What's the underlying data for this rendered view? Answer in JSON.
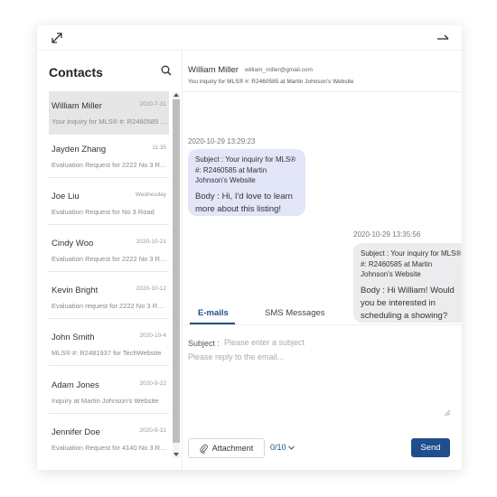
{
  "window": {
    "expand_icon": "expand-icon",
    "minimize_icon": "minimize-icon"
  },
  "contacts": {
    "title": "Contacts",
    "search_icon": "search-icon",
    "items": [
      {
        "name": "William Miller",
        "date": "2020-7-31",
        "preview": "Your inquiry for MLS® #: R2460585 at Martin Johnson's Website",
        "selected": true
      },
      {
        "name": "Jayden Zhang",
        "date": "11:35",
        "preview": "Evaluation Request for 2222 No 3 Road",
        "selected": false
      },
      {
        "name": "Joe Liu",
        "date": "Wednesday",
        "preview": "Evaluation Request for No 3 Road",
        "selected": false
      },
      {
        "name": "Cindy Woo",
        "date": "2020-10-21",
        "preview": "Evaluation Request for 2222 No 3 Road",
        "selected": false
      },
      {
        "name": "Kevin Bright",
        "date": "2020-10-12",
        "preview": "Evaluation request for 2222 No 3 Road",
        "selected": false
      },
      {
        "name": "John Smith",
        "date": "2020-10-4",
        "preview": "MLS® #: R2481937 for TechWebsite",
        "selected": false
      },
      {
        "name": "Adam Jones",
        "date": "2020-9-22",
        "preview": "Inquiry at Martin Johnson's Website",
        "selected": false
      },
      {
        "name": "Jennifer Doe",
        "date": "2020-8-31",
        "preview": "Evaluation Request for 4140 No 3 Road",
        "selected": false
      }
    ]
  },
  "conversation": {
    "name": "William Miller",
    "email": "william_miller@gmail.com",
    "subject": "You inquiry for MLS® #: R2460585 at Martin Johnson's Website",
    "messages": [
      {
        "time": "2020-10-29 13:29:23",
        "subject": "Subject : Your inquiry for MLS® #: R2460585 at Martin Johnson's Website",
        "body": "Body : Hi, I'd love to learn more about this listing!"
      },
      {
        "time": "2020-10-29 13:35:56",
        "subject": "Subject : Your inquiry for MLS® #: R2460585 at Martin Johnson's Website",
        "body": "Body : Hi William! Would you be interested in scheduling a showing?"
      }
    ]
  },
  "tabs": {
    "emails": "E-mails",
    "sms": "SMS Messages",
    "active": "emails"
  },
  "compose": {
    "subject_label": "Subject :",
    "subject_placeholder": "Please enter a subject",
    "body_placeholder": "Please reply to the email..."
  },
  "footer": {
    "attachment_label": "Attachment",
    "counter": "0/10",
    "send_label": "Send",
    "accent_color": "#1f4e8c"
  }
}
